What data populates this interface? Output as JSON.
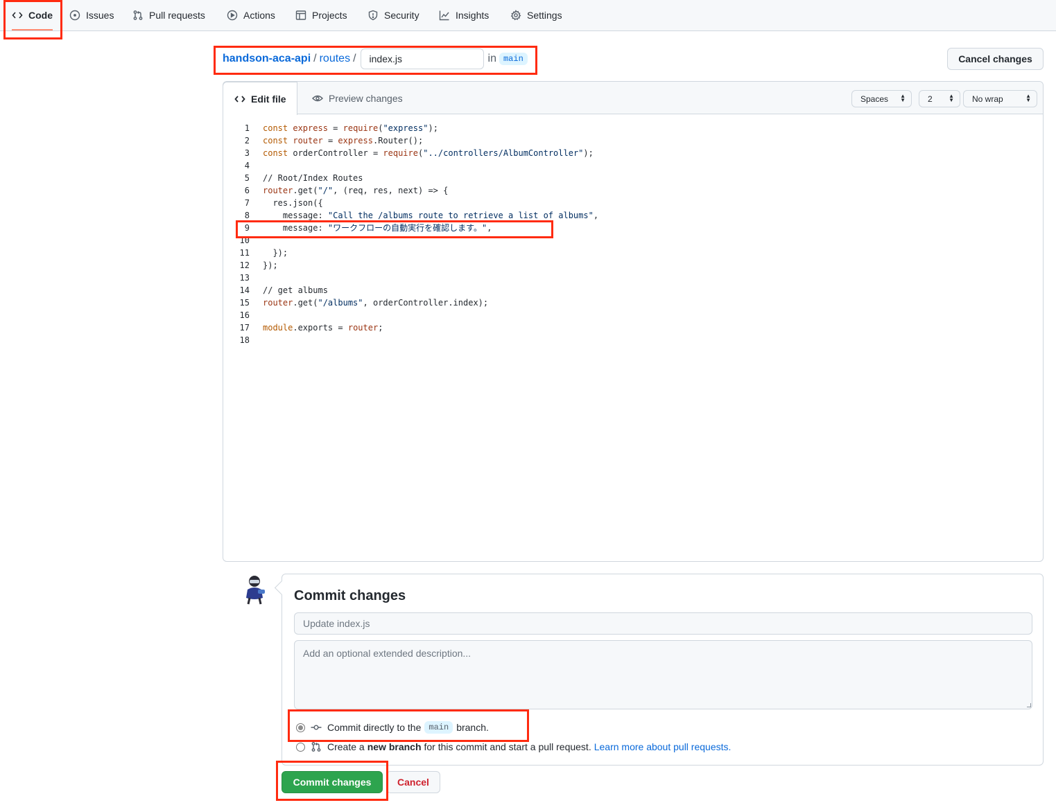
{
  "nav": {
    "code": "Code",
    "issues": "Issues",
    "pulls": "Pull requests",
    "actions": "Actions",
    "projects": "Projects",
    "security": "Security",
    "insights": "Insights",
    "settings": "Settings"
  },
  "breadcrumb": {
    "repo": "handson-aca-api",
    "folder": "routes",
    "filename": "index.js",
    "in": "in",
    "branch": "main"
  },
  "cancel_changes": "Cancel changes",
  "editor": {
    "tab_edit": "Edit file",
    "tab_preview": "Preview changes",
    "indent_mode": "Spaces",
    "indent_size": "2",
    "wrap_mode": "No wrap",
    "lines": [
      {
        "n": "1",
        "text": "const express = require(\"express\");"
      },
      {
        "n": "2",
        "text": "const router = express.Router();"
      },
      {
        "n": "3",
        "text": "const orderController = require(\"../controllers/AlbumController\");"
      },
      {
        "n": "4",
        "text": ""
      },
      {
        "n": "5",
        "text": "// Root/Index Routes"
      },
      {
        "n": "6",
        "text": "router.get(\"/\", (req, res, next) => {"
      },
      {
        "n": "7",
        "text": "  res.json({"
      },
      {
        "n": "8",
        "text": "    message: \"Call the /albums route to retrieve a list of albums\","
      },
      {
        "n": "9",
        "text": "    message: \"ワークフローの自動実行を確認します。\","
      },
      {
        "n": "10",
        "text": ""
      },
      {
        "n": "11",
        "text": "  });"
      },
      {
        "n": "12",
        "text": "});"
      },
      {
        "n": "13",
        "text": ""
      },
      {
        "n": "14",
        "text": "// get albums"
      },
      {
        "n": "15",
        "text": "router.get(\"/albums\", orderController.index);"
      },
      {
        "n": "16",
        "text": ""
      },
      {
        "n": "17",
        "text": "module.exports = router;"
      },
      {
        "n": "18",
        "text": ""
      }
    ]
  },
  "commit": {
    "title": "Commit changes",
    "summary_placeholder": "Update index.js",
    "description_placeholder": "Add an optional extended description...",
    "direct_prefix": "Commit directly to the",
    "direct_branch": "main",
    "direct_suffix": "branch.",
    "new_prefix": "Create a",
    "new_bold": "new branch",
    "new_suffix": "for this commit and start a pull request.",
    "learn_more": "Learn more about pull requests.",
    "submit": "Commit changes",
    "cancel": "Cancel"
  },
  "colors": {
    "accent_link": "#0969da",
    "primary_button": "#2da44e",
    "danger_text": "#cf222e",
    "highlight_box": "#ff2b10"
  }
}
